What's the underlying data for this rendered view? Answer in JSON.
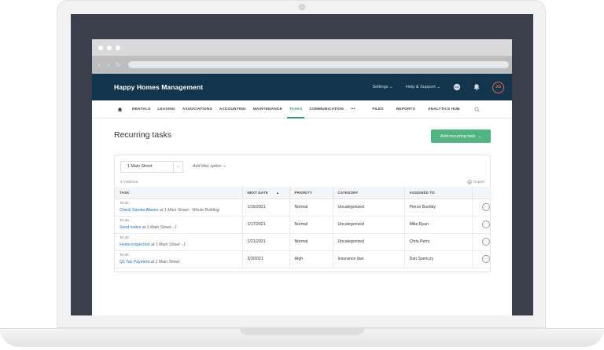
{
  "app": {
    "title": "Happy Homes Management",
    "settings_label": "Settings",
    "help_label": "Help & Support",
    "avatar_initials": "JG"
  },
  "nav": {
    "items": [
      "RENTALS",
      "LEASING",
      "ASSOCIATIONS",
      "ACCOUNTING",
      "MAINTENANCE",
      "TASKS",
      "COMMUNICATION",
      "•••",
      "FILES",
      "REPORTS",
      "ANALYTICS HUB"
    ],
    "active": "TASKS"
  },
  "page": {
    "title": "Recurring tasks",
    "add_button": "Add recurring task"
  },
  "filters": {
    "property": "1 Main Street",
    "add_filter": "Add filter option"
  },
  "results": {
    "count_text": "4 matches",
    "export_label": "Export"
  },
  "table": {
    "headers": [
      "TASK",
      "NEXT DATE",
      "PRIORITY",
      "CATEGORY",
      "ASSIGNED TO"
    ],
    "rows": [
      {
        "status": "To do",
        "link": "Check Smoke Alarms",
        "location": " at 1 Main Street - Whole Building",
        "next_date": "1/16/2021",
        "priority": "Normal",
        "category": "Uncategorized",
        "assigned": "Pierce Bushby"
      },
      {
        "status": "To do",
        "link": "Send notice",
        "location": " at 1 Main Street - 1",
        "next_date": "1/17/2021",
        "priority": "Normal",
        "category": "Uncategorized",
        "assigned": "Mike Ryan"
      },
      {
        "status": "To do",
        "link": "Home inspection",
        "location": " at 1 Main Street - 1",
        "next_date": "1/21/2021",
        "priority": "Normal",
        "category": "Uncategorized",
        "assigned": "Chris Perry"
      },
      {
        "status": "To do",
        "link": "Q1 Tax Payment",
        "location": " at 1 Main Street",
        "next_date": "3/3/2021",
        "priority": "High",
        "category": "Insurance due",
        "assigned": "Dan Szenczy"
      }
    ]
  },
  "colors": {
    "header_bg": "#11354c",
    "accent_green": "#52b382",
    "link_blue": "#1c6fb8",
    "avatar_ring": "#e56a4a"
  }
}
